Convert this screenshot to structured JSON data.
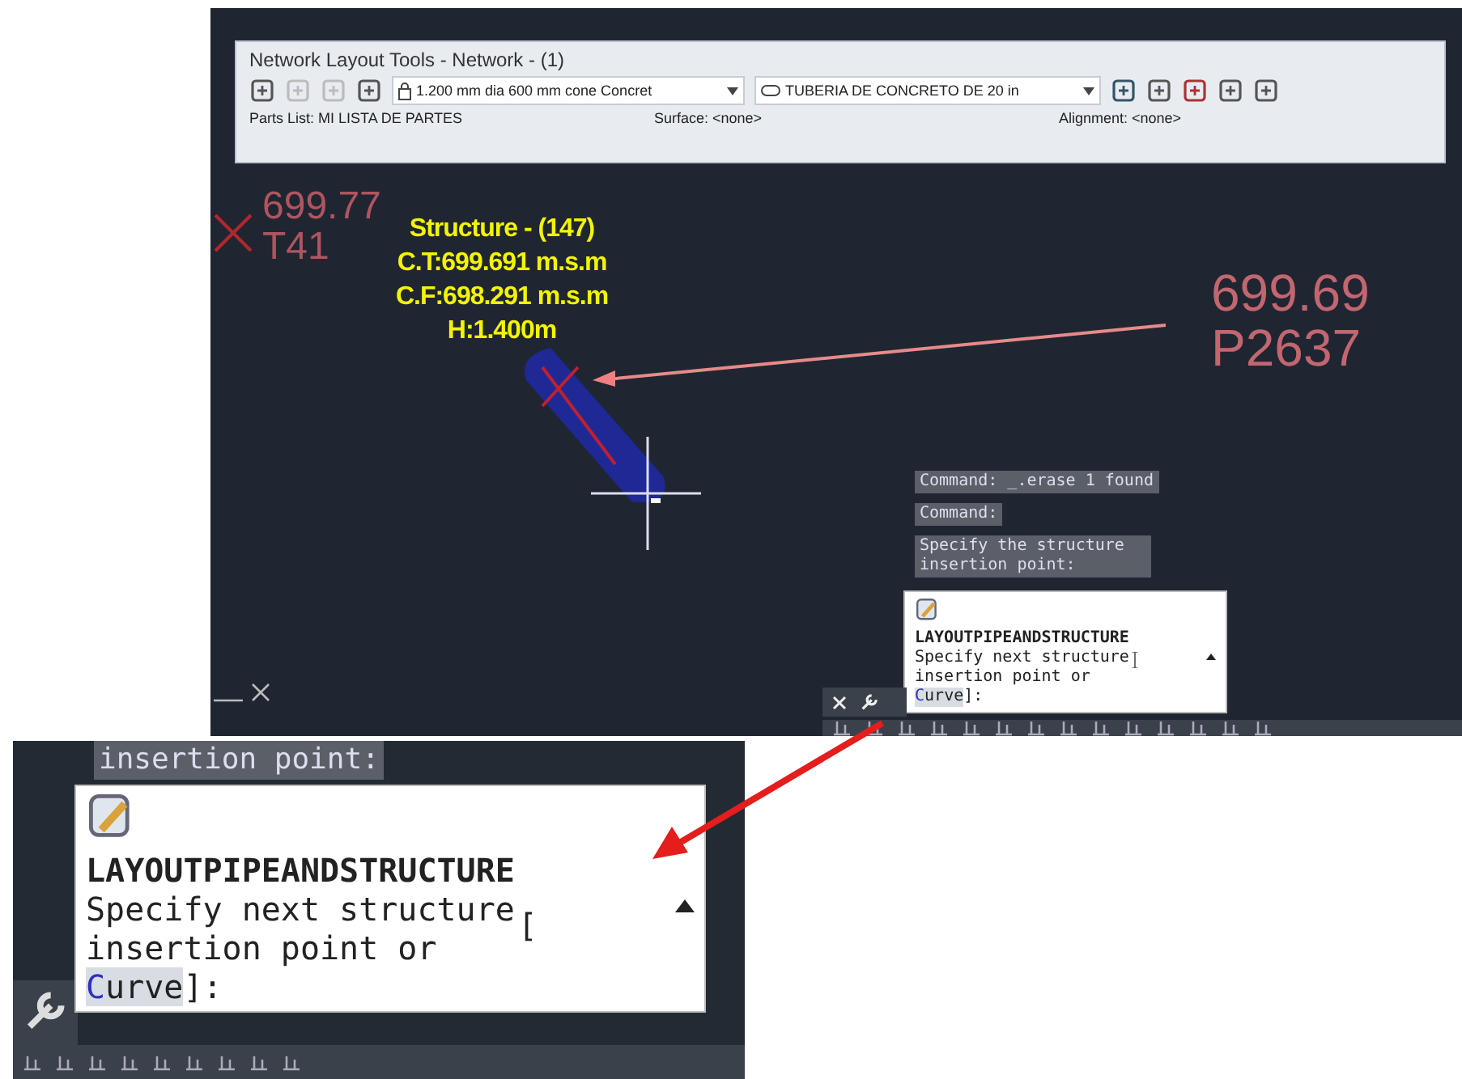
{
  "toolbar": {
    "title": "Network Layout Tools - Network - (1)",
    "structure_select": "1.200 mm dia 600 mm cone Concret",
    "pipe_select": "TUBERIA DE CONCRETO DE 20 in",
    "parts_list": "Parts List: MI LISTA DE PARTES",
    "surface": "Surface: <none>",
    "alignment": "Alignment: <none>"
  },
  "drawing": {
    "structure_label": [
      "Structure - (147)",
      "C.T:699.691 m.s.m",
      "C.F:698.291 m.s.m",
      "H:1.400m"
    ],
    "left_label": [
      "699.77",
      "T41"
    ],
    "right_label": [
      "699.69",
      "P2637"
    ]
  },
  "command_history": [
    "Command: _.erase 1 found",
    "Command:",
    "Specify the structure insertion point:"
  ],
  "prompt": {
    "command": "LAYOUTPIPEANDSTRUCTURE",
    "line_1": "Specify next structure",
    "line_2": "insertion point or",
    "option": "Curve",
    "suffix": "]:"
  },
  "inset": {
    "history_tail": "insertion point:",
    "prompt": {
      "command": "LAYOUTPIPEANDSTRUCTURE",
      "line_1": "Specify next structure",
      "bracket": "[",
      "line_2": "insertion point or",
      "option": "Curve",
      "suffix": "]:"
    }
  }
}
